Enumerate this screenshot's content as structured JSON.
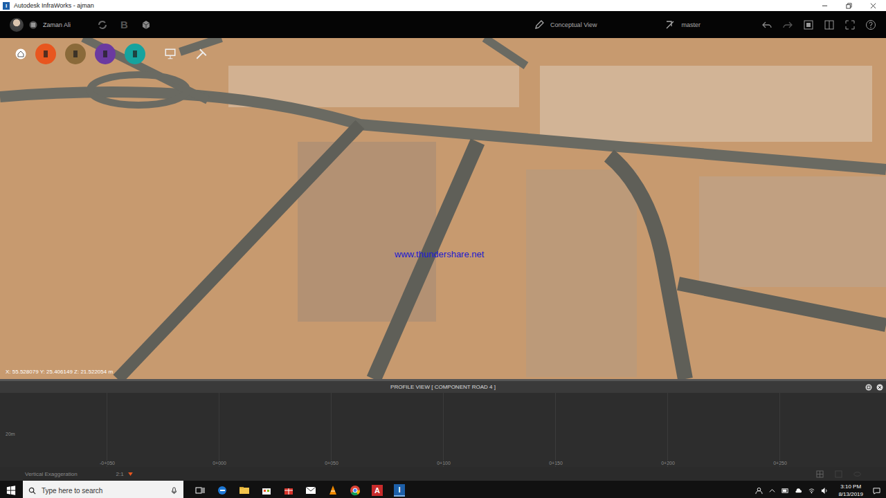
{
  "window": {
    "title": "Autodesk InfraWorks - ajman",
    "app_icon_letter": "I"
  },
  "toolbar": {
    "user": "Zaman Ali",
    "b_icon_letter": "B",
    "view": "Conceptual View",
    "branch": "master"
  },
  "tools": [
    {
      "color": "#e8561f"
    },
    {
      "color": "#8a6a3a"
    },
    {
      "color": "#6b3aa0"
    },
    {
      "color": "#16a39e"
    }
  ],
  "viewport": {
    "watermark": "www.thundershare.net",
    "coordinates": "X: 55.528079 Y: 25.406149 Z: 21.522054 m"
  },
  "profile": {
    "title": "PROFILE VIEW [ COMPONENT ROAD 4 ]",
    "y_label": "20m",
    "stations": [
      "-0+050",
      "0+000",
      "0+050",
      "0+100",
      "0+150",
      "0+200",
      "0+250"
    ],
    "exaggeration_label": "Vertical Exaggeration",
    "exaggeration_value": "2:1"
  },
  "taskbar": {
    "search_placeholder": "Type here to search",
    "autocad_letter": "A",
    "infraworks_letter": "I",
    "time": "3:10 PM",
    "date": "8/13/2019"
  }
}
